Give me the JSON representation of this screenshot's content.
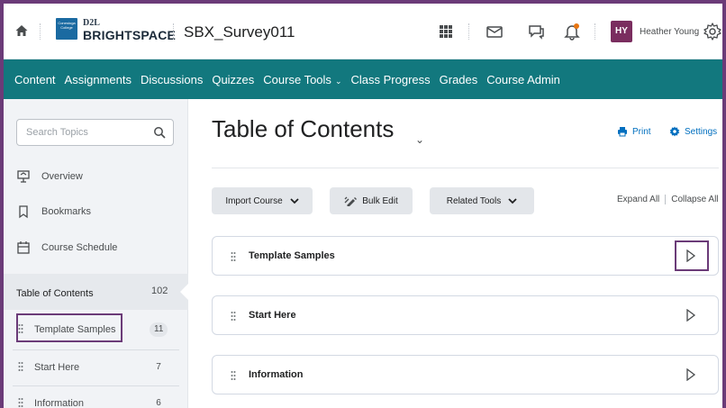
{
  "topbar": {
    "logo_small_text": "Conestoga College",
    "logo_d2l": "D2L",
    "logo_brand": "BRIGHTSPACE",
    "course_title": "SBX_Survey011",
    "user_initials": "HY",
    "user_name": "Heather Young"
  },
  "nav": {
    "items": [
      {
        "label": "Content"
      },
      {
        "label": "Assignments"
      },
      {
        "label": "Discussions"
      },
      {
        "label": "Quizzes"
      },
      {
        "label": "Course Tools"
      },
      {
        "label": "Class Progress"
      },
      {
        "label": "Grades"
      },
      {
        "label": "Course Admin"
      }
    ],
    "dropdown_chevron": "⌄"
  },
  "sidebar": {
    "search_placeholder": "Search Topics",
    "links": [
      {
        "label": "Overview",
        "icon": "overview-icon"
      },
      {
        "label": "Bookmarks",
        "icon": "bookmark-icon"
      },
      {
        "label": "Course Schedule",
        "icon": "calendar-icon"
      }
    ],
    "toc": {
      "label": "Table of Contents",
      "count": "102"
    },
    "modules": [
      {
        "label": "Template Samples",
        "count": "11"
      },
      {
        "label": "Start Here",
        "count": "7"
      },
      {
        "label": "Information",
        "count": "6"
      }
    ]
  },
  "main": {
    "title": "Table of Contents",
    "print_label": "Print",
    "settings_label": "Settings",
    "buttons": {
      "import_course": "Import Course",
      "bulk_edit": "Bulk Edit",
      "related_tools": "Related Tools"
    },
    "expand_all": "Expand All",
    "collapse_all": "Collapse All",
    "modules": [
      {
        "label": "Template Samples"
      },
      {
        "label": "Start Here"
      },
      {
        "label": "Information"
      }
    ]
  },
  "colors": {
    "nav_bg": "#12787e",
    "frame_border": "#6b3b78",
    "link_blue": "#006fbf",
    "avatar_bg": "#7a2d5f",
    "notification_dot": "#e87511"
  }
}
